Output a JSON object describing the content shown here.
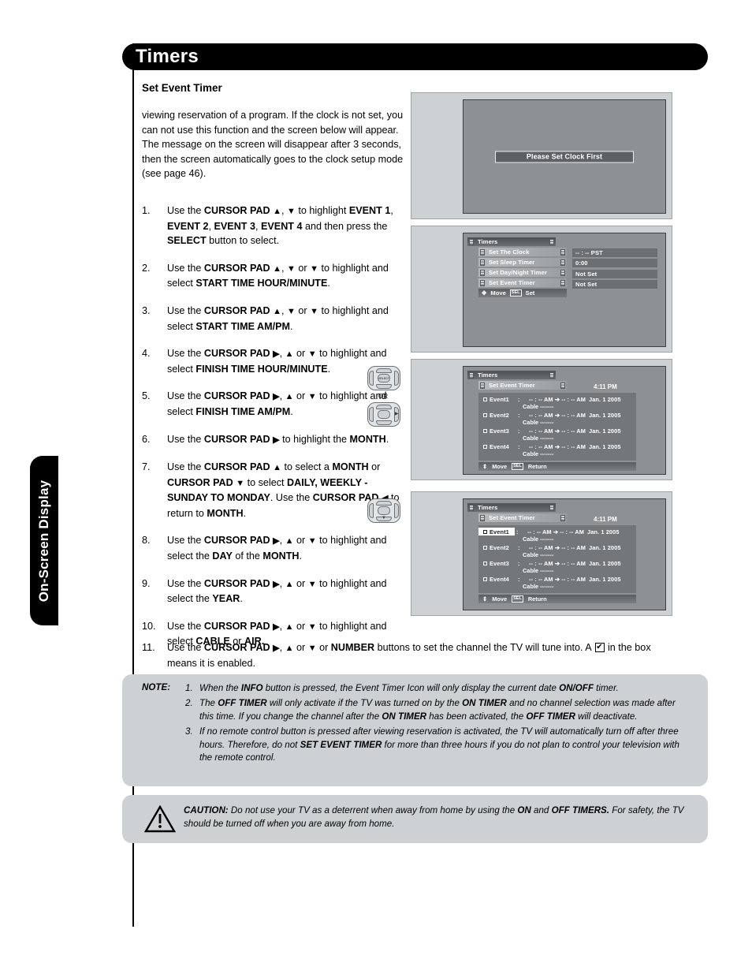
{
  "page": {
    "sidebar_tab": "On-Screen Display",
    "header_title": "Timers",
    "section_title": "Set Event Timer"
  },
  "intro": "viewing reservation of a program. If the clock is not set, you can not use this function and the screen below will appear. The message on the screen will disappear after 3 seconds, then the screen automatically goes to the clock setup mode (see page 46).",
  "steps": [
    {
      "num": "1.",
      "html": "Use the <b>CURSOR PAD <span class='ar'>▲</span></b>, <b><span class='ar'>▼</span></b> to highlight <b>EVENT 1</b>, <b>EVENT 2</b>, <b>EVENT 3</b>, <b>EVENT 4</b> and then press the <b>SELECT</b> button to select."
    },
    {
      "num": "2.",
      "html": "Use the <b>CURSOR PAD <span class='ar'>▲</span></b>, <b><span class='ar'>▼</span></b> or <b><span class='ar'>▼</span></b> to highlight and select <b>START TIME HOUR/MINUTE</b>."
    },
    {
      "num": "3.",
      "html": "Use the <b>CURSOR PAD <span class='ar'>▲</span></b>, <b><span class='ar'>▼</span></b> or <b><span class='ar'>▼</span></b> to highlight and select <b>START TIME AM/PM</b>."
    },
    {
      "num": "4.",
      "html": "Use the <b>CURSOR PAD <span class='ar'>▶</span></b>, <b><span class='ar'>▲</span></b> or <b><span class='ar'>▼</span></b> to highlight and select <b>FINISH TIME HOUR/MINUTE</b>."
    },
    {
      "num": "5.",
      "html": "Use the <b>CURSOR PAD <span class='ar'>▶</span></b>, <b><span class='ar'>▲</span></b> or <b><span class='ar'>▼</span></b> to highlight and select <b>FINISH TIME AM/PM</b>."
    },
    {
      "num": "6.",
      "html": "Use the <b>CURSOR PAD <span class='ar'>▶</span></b> to highlight the <b>MONTH</b>."
    },
    {
      "num": "7.",
      "html": "Use the <b>CURSOR PAD <span class='ar'>▲</span></b> to select a <b>MONTH</b> or <b>CURSOR PAD <span class='ar'>▼</span></b> to select <b>DAILY, WEEKLY - SUNDAY TO MONDAY</b>. Use the <b>CURSOR PAD <span class='ar'>◀</span></b> to return to <b>MONTH</b>."
    },
    {
      "num": "8.",
      "html": "Use the <b>CURSOR PAD <span class='ar'>▶</span></b>, <b><span class='ar'>▲</span></b> or <b><span class='ar'>▼</span></b> to highlight and select the <b>DAY</b> of the <b>MONTH</b>."
    },
    {
      "num": "9.",
      "html": "Use the <b>CURSOR PAD <span class='ar'>▶</span></b>, <b><span class='ar'>▲</span></b> or <b><span class='ar'>▼</span></b> to highlight and select the <b>YEAR</b>."
    },
    {
      "num": "10.",
      "html": "Use the <b>CURSOR PAD <span class='ar'>▶</span></b>, <b><span class='ar'>▲</span></b> or <b><span class='ar'>▼</span></b> to highlight and select <b>CABLE</b> or <b>AIR.</b>"
    }
  ],
  "step11": {
    "num": "11.",
    "html_before": "Use the <b>CURSOR PAD <span class='ar'>▶</span></b>, <b><span class='ar'>▲</span></b> or <b><span class='ar'>▼</span></b> or <b>NUMBER</b> buttons to set the channel the TV will tune into. A ",
    "html_after": " in the box means it is enabled."
  },
  "figures": {
    "fig1": {
      "message": "Please Set Clock First"
    },
    "fig2": {
      "title": "Timers",
      "items": [
        "Set The Clock",
        "Set Sleep Timer",
        "Set Day/Night Timer",
        "Set Event Timer"
      ],
      "values": [
        "-- : --  PST",
        "0:00",
        "Not Set",
        "Not Set"
      ],
      "footer_move": "Move",
      "footer_sel_key": "SEL",
      "footer_action": "Set"
    },
    "fig3": {
      "title": "Timers",
      "submenu": "Set Event Timer",
      "clock": "4:11 PM",
      "events": [
        {
          "name": "Event1",
          "colon": ":",
          "times": "-- : -- AM  ➔ -- : -- AM",
          "date": "Jan. 1 2005",
          "sub": "Cable    -------",
          "highlighted": false
        },
        {
          "name": "Event2",
          "colon": ":",
          "times": "-- : -- AM  ➔ -- : -- AM",
          "date": "Jan. 1 2005",
          "sub": "Cable    -------",
          "highlighted": false
        },
        {
          "name": "Event3",
          "colon": ":",
          "times": "-- : -- AM  ➔ -- : -- AM",
          "date": "Jan. 1 2005",
          "sub": "Cable    -------",
          "highlighted": false
        },
        {
          "name": "Event4",
          "colon": ":",
          "times": "-- : -- AM  ➔ -- : -- AM",
          "date": "Jan. 1 2005",
          "sub": "Cable    -------",
          "highlighted": false
        }
      ],
      "footer_move": "Move",
      "footer_sel_key": "SEL",
      "footer_action": "Return",
      "remote_or_label": "OR"
    },
    "fig4": {
      "title": "Timers",
      "submenu": "Set Event Timer",
      "clock": "4:11 PM",
      "events": [
        {
          "name": "Event1",
          "colon": ":",
          "times": "-- : -- AM  ➔ -- : -- AM",
          "date": "Jan. 1 2005",
          "sub": "Cable    -------",
          "highlighted": true
        },
        {
          "name": "Event2",
          "colon": ":",
          "times": "-- : -- AM  ➔ -- : -- AM",
          "date": "Jan. 1 2005",
          "sub": "Cable    -------",
          "highlighted": false
        },
        {
          "name": "Event3",
          "colon": ":",
          "times": "-- : -- AM  ➔ -- : -- AM",
          "date": "Jan. 1 2005",
          "sub": "Cable    -------",
          "highlighted": false
        },
        {
          "name": "Event4",
          "colon": ":",
          "times": "-- : -- AM  ➔ -- : -- AM",
          "date": "Jan. 1 2005",
          "sub": "Cable    -------",
          "highlighted": false
        }
      ],
      "footer_move": "Move",
      "footer_sel_key": "SEL",
      "footer_action": "Return"
    },
    "remote_center_label": "SELECT"
  },
  "note": {
    "label": "NOTE:",
    "items": [
      {
        "num": "1.",
        "html": "When the <b>INFO</b> button is pressed, the Event Timer Icon will only display the current date <b>ON/OFF</b> timer."
      },
      {
        "num": "2.",
        "html": "The <b>OFF TIMER</b> will only activate if the TV was turned on by the <b>ON TIMER</b> and no channel selection was made after this time. If you change the channel after the <b>ON TIMER</b> has been activated, the <b>OFF TIMER</b> will deactivate."
      },
      {
        "num": "3.",
        "html": "If no remote control button is pressed after viewing reservation is activated, the TV will automatically turn off after three hours. Therefore, do not <b>SET EVENT TIMER</b> for more than three hours if you do not plan to control your television with the remote control."
      }
    ]
  },
  "caution": {
    "label": "CAUTION:",
    "html": "Do not use your TV as a deterrent when away from home by using the <b>ON</b> and <b>OFF TIMERS.</b> For safety, the TV should be turned off when you are away from home."
  },
  "colors": {
    "header_bg": "#000000",
    "panel_bg": "#cdd1d3",
    "tv_screen": "#8e9194",
    "osd_value": "#6c6f72"
  }
}
